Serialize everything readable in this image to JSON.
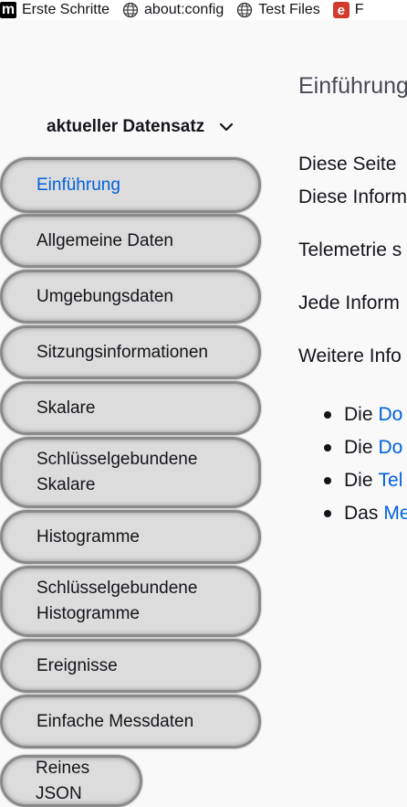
{
  "bookmarks": [
    {
      "label": "Erste Schritte",
      "icon": "m-logo-icon"
    },
    {
      "label": "about:config",
      "icon": "globe-icon"
    },
    {
      "label": "Test Files",
      "icon": "globe-icon"
    },
    {
      "label": "F",
      "icon": "e-logo-icon"
    }
  ],
  "category": {
    "selected": "aktueller Datensatz",
    "icon": "chevron-down-icon"
  },
  "nav": [
    {
      "label": "Einführung",
      "selected": true
    },
    {
      "label": "Allgemeine Daten"
    },
    {
      "label": "Umgebungsdaten"
    },
    {
      "label": "Sitzungsinformationen"
    },
    {
      "label": "Skalare"
    },
    {
      "label": "Schlüsselgebundene Skalare"
    },
    {
      "label": "Histogramme"
    },
    {
      "label": "Schlüsselgebundene Histogramme"
    },
    {
      "label": "Ereignisse"
    },
    {
      "label": "Einfache Messdaten"
    },
    {
      "label": "Reines JSON"
    }
  ],
  "main": {
    "title": "Einführung",
    "paragraphs": [
      "Diese Seite",
      "Diese Inform",
      "Telemetrie s",
      "Jede Inform",
      "Weitere Info"
    ],
    "list": [
      {
        "prefix": "Die",
        "link": "Do"
      },
      {
        "prefix": "Die",
        "link": "Do"
      },
      {
        "prefix": "Die",
        "link": "Tel"
      },
      {
        "prefix": "Das",
        "link": "Me"
      }
    ]
  },
  "colors": {
    "accent": "#0060df",
    "sidebar_item_bg": "#dcdcdc",
    "page_bg": "#f9f9fa"
  }
}
